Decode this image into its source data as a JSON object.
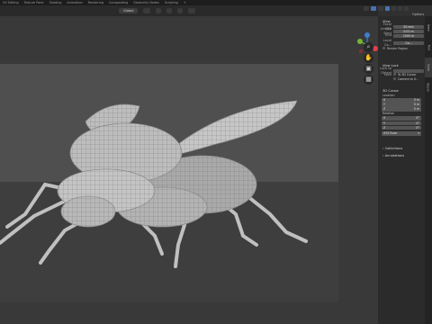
{
  "workspace_tabs": [
    "UV Editing",
    "Texture Paint",
    "Shading",
    "Animation",
    "Rendering",
    "Compositing",
    "Geometry Nodes",
    "Scripting",
    "+"
  ],
  "header": {
    "orientation_dropdown": "Global"
  },
  "options_label": "Options",
  "npanel": {
    "view": {
      "title": "View",
      "focal_label": "Focal Length",
      "focal_value": "50 mm",
      "clip_start_label": "Clip Start",
      "clip_start_value": "0.01 m",
      "clip_end_label": "End",
      "clip_end_value": "1000 m",
      "local_camera_label": "Local Ca...",
      "local_camera_value": "Ca...",
      "render_region_label": "Render Region"
    },
    "view_lock": {
      "title": "View Lock",
      "lock_to_object_label": "Lock to Object",
      "lock_label": "Lock",
      "to_3d_cursor_label": "To 3D Cursor",
      "camera_to_view_label": "Camera to V..."
    },
    "cursor": {
      "title": "3D Cursor",
      "location_label": "Location",
      "location": [
        {
          "axis": "X",
          "value": "0 m"
        },
        {
          "axis": "Y",
          "value": "0 m"
        },
        {
          "axis": "Z",
          "value": "0 m"
        }
      ],
      "rotation_label": "Rotation",
      "rotation": [
        {
          "axis": "X",
          "value": "0°"
        },
        {
          "axis": "Y",
          "value": "0°"
        },
        {
          "axis": "Z",
          "value": "0°"
        }
      ],
      "mode_value": "XYZ Euler"
    },
    "collections_title": "Collections",
    "annotations_title": "Annotations"
  },
  "side_tabs": [
    "Item",
    "Tool",
    "View",
    "Bevel"
  ],
  "gizmo": {
    "x_color": "#e0414d",
    "y_color": "#74b335",
    "z_color": "#3f7fd1"
  },
  "colors": {
    "accent": "#4772b3",
    "highlight": "#3f5c87"
  }
}
